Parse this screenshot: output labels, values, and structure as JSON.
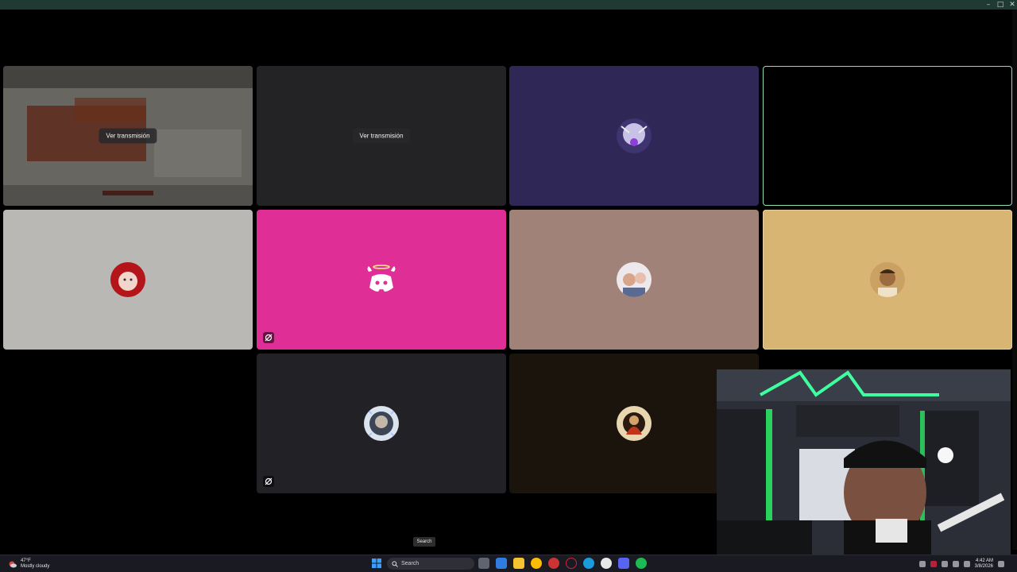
{
  "window": {
    "controls": [
      {
        "name": "minimize",
        "glyph": "–"
      },
      {
        "name": "maximize",
        "glyph": "□"
      },
      {
        "name": "close",
        "glyph": "✕"
      }
    ]
  },
  "tiles": [
    {
      "id": "stream-1",
      "type": "stream",
      "bg": "#3a3a3a",
      "button_label": "Ver transmisión"
    },
    {
      "id": "stream-2",
      "type": "stream",
      "bg": "#232325",
      "button_label": "Ver transmisión"
    },
    {
      "id": "user-3",
      "type": "avatar",
      "bg": "#2f2755",
      "icon": "anime-avatar-icon"
    },
    {
      "id": "user-4",
      "type": "video",
      "bg": "#000000",
      "active": true
    },
    {
      "id": "user-5",
      "type": "avatar",
      "bg": "#b9b8b5",
      "icon": "red-hood-avatar-icon"
    },
    {
      "id": "user-6",
      "type": "avatar",
      "bg": "#df2e96",
      "icon": "discord-logo-icon",
      "muted": true
    },
    {
      "id": "user-7",
      "type": "avatar",
      "bg": "#a08278",
      "icon": "photo-avatar-icon"
    },
    {
      "id": "user-8",
      "type": "avatar",
      "bg": "#d9b573",
      "icon": "man-avatar-icon"
    },
    {
      "id": "user-9",
      "type": "avatar",
      "bg": "#222226",
      "icon": "snowflake-avatar-icon",
      "muted": true
    },
    {
      "id": "user-10",
      "type": "avatar",
      "bg": "#1a140c",
      "icon": "gold-avatar-icon"
    }
  ],
  "tooltip": {
    "text": "Search"
  },
  "taskbar": {
    "weather": {
      "temp": "47°F",
      "condition": "Mostly cloudy"
    },
    "search_placeholder": "Search",
    "clock": {
      "time": "4:42 AM",
      "date": "3/8/2026"
    },
    "colors": {
      "accent": "#3aa0ff",
      "spotify": "#1db954",
      "discord": "#5865f2",
      "chrome": "#fbbc04",
      "edge": "#1a9cdc"
    }
  }
}
